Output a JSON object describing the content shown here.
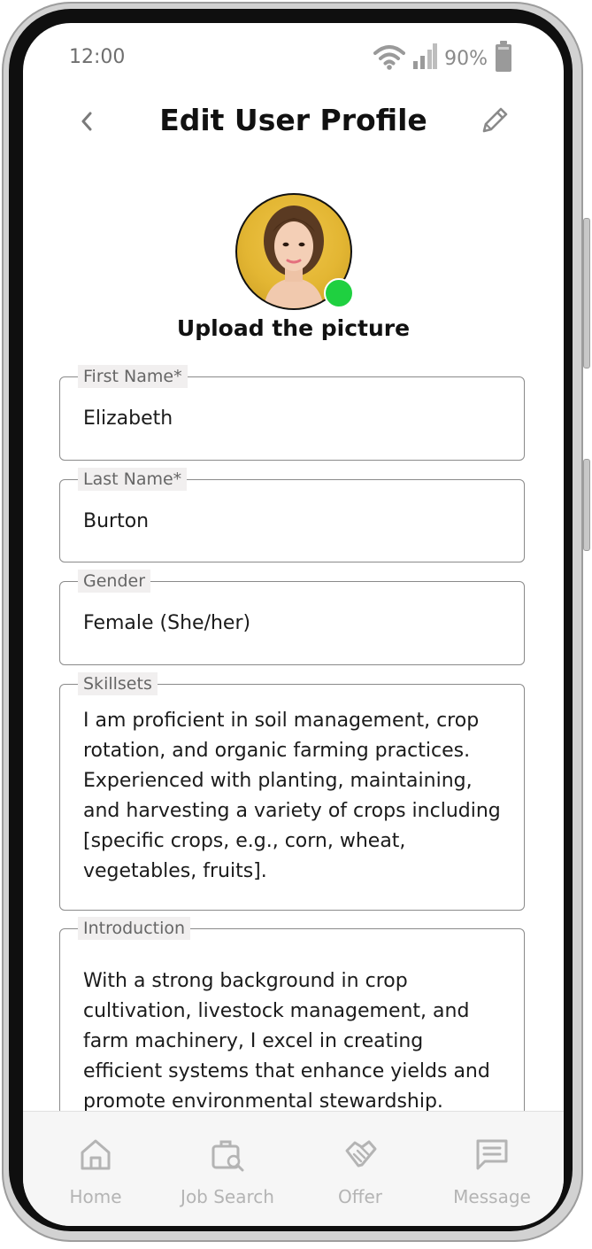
{
  "status_bar": {
    "time": "12:00",
    "battery_percent": "90%"
  },
  "header": {
    "title": "Edit User Profile"
  },
  "profile": {
    "upload_label": "Upload the picture",
    "online_color": "#1fd040"
  },
  "form": {
    "first_name": {
      "label": "First Name*",
      "value": "Elizabeth"
    },
    "last_name": {
      "label": "Last Name*",
      "value": "Burton"
    },
    "gender": {
      "label": "Gender",
      "value": "Female (She/her)"
    },
    "skillsets": {
      "label": "Skillsets",
      "value": "I am proficient in soil management, crop rotation, and organic farming practices. Experienced with planting, maintaining, and harvesting a variety of crops including [specific crops, e.g., corn, wheat, vegetables, fruits]."
    },
    "introduction": {
      "label": "Introduction",
      "value": "With a strong background in crop cultivation, livestock management, and farm machinery, I excel in creating efficient systems that enhance yields and promote environmental stewardship."
    }
  },
  "bottom_nav": {
    "items": [
      {
        "label": "Home",
        "icon": "home-icon"
      },
      {
        "label": "Job Search",
        "icon": "job-search-icon"
      },
      {
        "label": "Offer",
        "icon": "handshake-icon"
      },
      {
        "label": "Message",
        "icon": "message-icon"
      }
    ]
  }
}
